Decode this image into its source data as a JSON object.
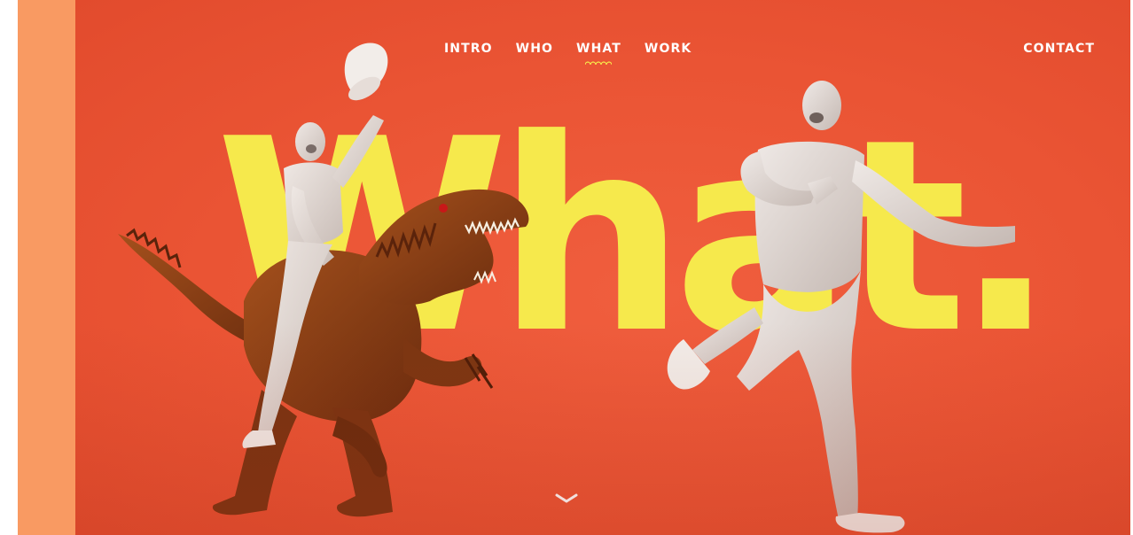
{
  "nav": {
    "items": [
      {
        "label": "INTRO",
        "active": false
      },
      {
        "label": "WHO",
        "active": false
      },
      {
        "label": "WHAT",
        "active": true
      },
      {
        "label": "WORK",
        "active": false
      }
    ],
    "contact_label": "CONTACT"
  },
  "hero": {
    "headline": "What.",
    "figures": [
      "man-riding-dinosaur-figure",
      "running-man-figure"
    ],
    "scroll_icon": "chevron-down-icon"
  },
  "colors": {
    "background": "#ea5434",
    "stripe": "#f99a62",
    "headline": "#f6e94c",
    "nav_text": "#ffffff",
    "active_underline": "#f6e24a",
    "dinosaur": "#8a3f14",
    "figurine": "#ddd3cf"
  }
}
